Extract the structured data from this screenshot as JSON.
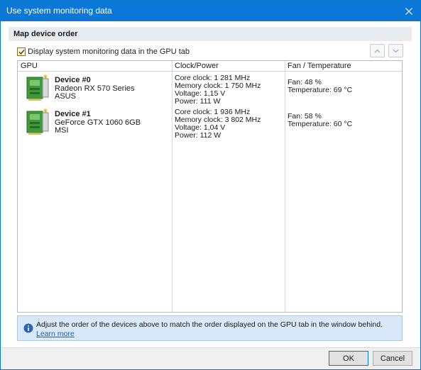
{
  "window": {
    "title": "Use system monitoring data"
  },
  "group": {
    "header": "Map device order"
  },
  "checkbox": {
    "label": "Display system monitoring data in the GPU tab",
    "checked": true
  },
  "table": {
    "headers": {
      "gpu": "GPU",
      "clock": "Clock/Power",
      "fan": "Fan / Temperature"
    },
    "rows": [
      {
        "name": "Device #0",
        "model": "Radeon RX 570 Series",
        "vendor": "ASUS",
        "clock": [
          "Core clock: 1 281 MHz",
          "Memory clock: 1 750 MHz",
          "Voltage: 1,15 V",
          "Power: 111 W"
        ],
        "fan": [
          "Fan: 48 %",
          "Temperature: 69 °C"
        ]
      },
      {
        "name": "Device #1",
        "model": "GeForce GTX 1060 6GB",
        "vendor": "MSI",
        "clock": [
          "Core clock: 1 936 MHz",
          "Memory clock: 3 802 MHz",
          "Voltage: 1,04 V",
          "Power: 112 W"
        ],
        "fan": [
          "Fan: 58 %",
          "Temperature: 60 °C"
        ]
      }
    ]
  },
  "info": {
    "text": "Adjust the order of the devices above to match the order displayed on the GPU tab in the window behind.",
    "link": "Learn more"
  },
  "buttons": {
    "ok": "OK",
    "cancel": "Cancel"
  },
  "icons": {
    "close": "close-icon",
    "up": "chevron-up-icon",
    "down": "chevron-down-icon",
    "gpu": "gpu-card-icon",
    "info": "info-icon"
  },
  "colors": {
    "titlebar": "#0b78d7",
    "info_bg": "#d9e9f9",
    "link": "#1a5fb4"
  }
}
